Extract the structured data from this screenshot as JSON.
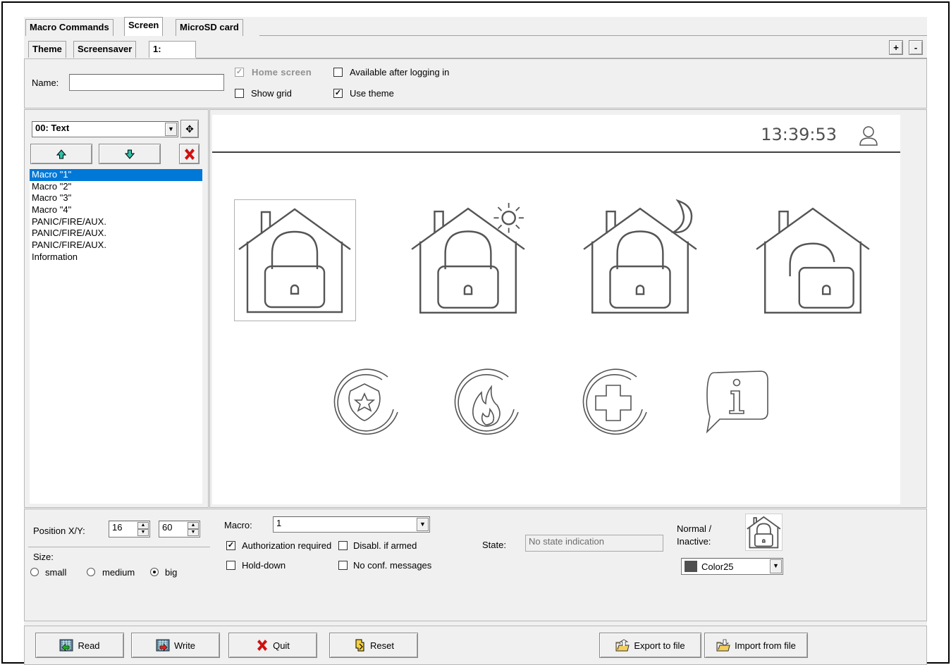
{
  "tabs": {
    "main": [
      "Macro Commands",
      "Screen",
      "MicroSD card"
    ],
    "sub": [
      "Theme",
      "Screensaver",
      "1:"
    ],
    "plus": "+",
    "minus": "-"
  },
  "header": {
    "name_label": "Name:",
    "name_value": "",
    "home_screen": "Home screen",
    "available_after_login": "Available after logging in",
    "show_grid": "Show grid",
    "use_theme": "Use theme"
  },
  "element_select": "00: Text",
  "macro_list": [
    "Macro \"1\"",
    "Macro \"2\"",
    "Macro \"3\"",
    "Macro \"4\"",
    "PANIC/FIRE/AUX.",
    "PANIC/FIRE/AUX.",
    "PANIC/FIRE/AUX.",
    "Information"
  ],
  "preview": {
    "clock": "13:39:53"
  },
  "props": {
    "position_label": "Position X/Y:",
    "pos_x": "16",
    "pos_y": "60",
    "size_label": "Size:",
    "size_small": "small",
    "size_medium": "medium",
    "size_big": "big",
    "macro_label": "Macro:",
    "macro_value": "1",
    "auth_required": "Authorization required",
    "disabl_if_armed": "Disabl. if armed",
    "hold_down": "Hold-down",
    "no_conf": "No conf. messages",
    "state_label": "State:",
    "state_value": "No state indication",
    "normal_inactive_1": "Normal /",
    "normal_inactive_2": "Inactive:",
    "color_value": "Color25",
    "color_swatch": "#505050"
  },
  "footer": {
    "read": "Read",
    "write": "Write",
    "quit": "Quit",
    "reset": "Reset",
    "export": "Export to file",
    "import": "Import from file"
  }
}
